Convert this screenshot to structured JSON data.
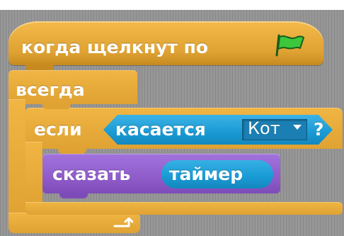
{
  "blocks": {
    "hat_label": "когда щелкнут по",
    "forever_label": "всегда",
    "if_label": "если",
    "touching_label": "касается",
    "touching_target": "Кот",
    "touching_question": "?",
    "say_label": "сказать",
    "timer_label": "таймер"
  },
  "icons": {
    "hat": "green-flag-icon",
    "dropdown": "dropdown-arrow-icon",
    "loop": "loop-arrow-icon"
  },
  "colors": {
    "control": "#dfa233",
    "sensing": "#199ad4",
    "looks": "#8f5cc9",
    "flag": "#3cc73c",
    "background": "#979797"
  }
}
